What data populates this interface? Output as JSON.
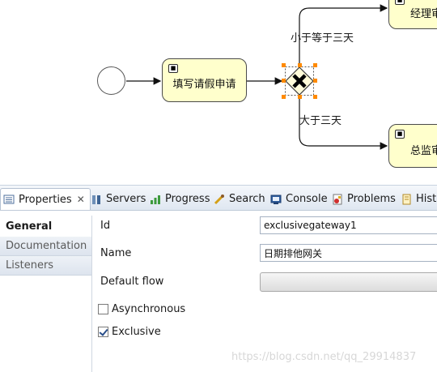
{
  "diagram": {
    "tasks": {
      "leave_request": "填写请假申请",
      "manager_approval": "经理审",
      "director_approval": "总监审"
    },
    "flows": {
      "less_than_three": "小于等于三天",
      "greater_than_three": "大于三天"
    },
    "colors": {
      "task_fill": "#ffffcc",
      "handle": "#ff8a00",
      "gateway_fill": "#fffbd9"
    }
  },
  "tabs": [
    {
      "label": "Properties",
      "icon": "properties-icon",
      "active": true
    },
    {
      "label": "Servers",
      "icon": "servers-icon"
    },
    {
      "label": "Progress",
      "icon": "progress-icon"
    },
    {
      "label": "Search",
      "icon": "search-icon"
    },
    {
      "label": "Console",
      "icon": "console-icon"
    },
    {
      "label": "Problems",
      "icon": "problems-icon"
    },
    {
      "label": "Histo",
      "icon": "history-icon"
    }
  ],
  "sidebar": {
    "items": [
      {
        "label": "General",
        "active": true
      },
      {
        "label": "Documentation"
      },
      {
        "label": "Listeners"
      }
    ]
  },
  "properties": {
    "id_label": "Id",
    "id_value": "exclusivegateway1",
    "name_label": "Name",
    "name_value": "日期排他网关",
    "default_flow_label": "Default flow",
    "default_flow_value": "",
    "asynchronous_label": "Asynchronous",
    "asynchronous_checked": false,
    "exclusive_label": "Exclusive",
    "exclusive_checked": true
  },
  "watermark": "https://blog.csdn.net/qq_29914837"
}
